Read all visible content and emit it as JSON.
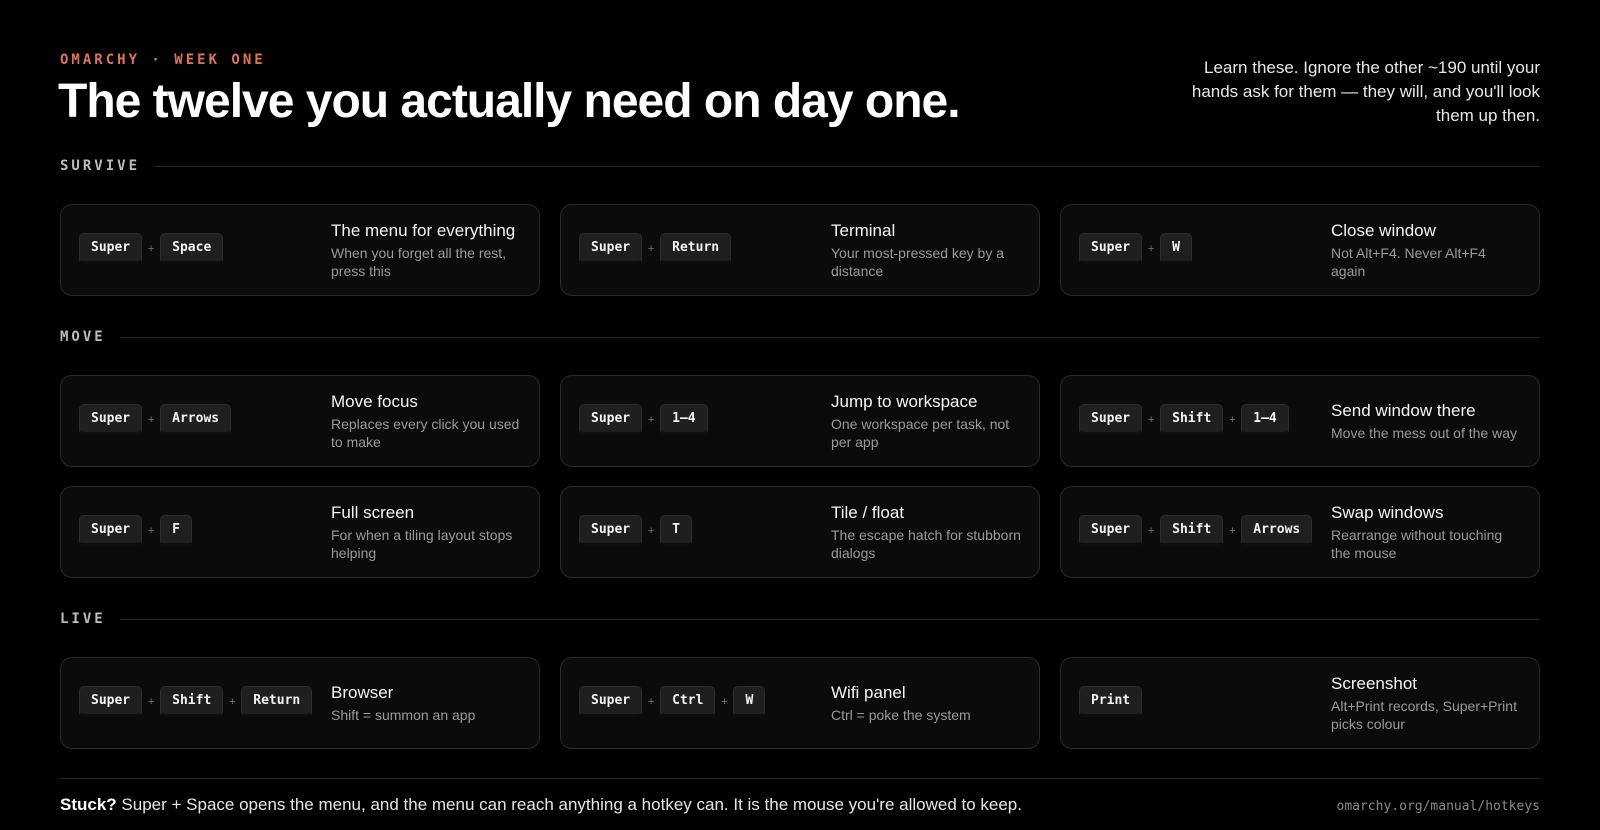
{
  "header": {
    "eyebrow": "OMARCHY · WEEK ONE",
    "title": "The twelve you actually need on day one.",
    "intro": "Learn these. Ignore the other ~190 until your hands ask for them — they will, and you'll look them up then."
  },
  "sections": {
    "survive": "SURVIVE",
    "move": "MOVE",
    "live": "LIVE"
  },
  "cards": [
    {
      "keys": [
        "Super",
        "Space"
      ],
      "title": "The menu for everything",
      "desc": "When you forget all the rest, press this"
    },
    {
      "keys": [
        "Super",
        "Return"
      ],
      "title": "Terminal",
      "desc": "Your most-pressed key by a distance"
    },
    {
      "keys": [
        "Super",
        "W"
      ],
      "title": "Close window",
      "desc": "Not Alt+F4. Never Alt+F4 again"
    },
    {
      "keys": [
        "Super",
        "Arrows"
      ],
      "title": "Move focus",
      "desc": "Replaces every click you used to make"
    },
    {
      "keys": [
        "Super",
        "1–4"
      ],
      "title": "Jump to workspace",
      "desc": "One workspace per task, not per app"
    },
    {
      "keys": [
        "Super",
        "Shift",
        "1–4"
      ],
      "title": "Send window there",
      "desc": "Move the mess out of the way"
    },
    {
      "keys": [
        "Super",
        "F"
      ],
      "title": "Full screen",
      "desc": "For when a tiling layout stops helping"
    },
    {
      "keys": [
        "Super",
        "T"
      ],
      "title": "Tile / float",
      "desc": "The escape hatch for stubborn dialogs"
    },
    {
      "keys": [
        "Super",
        "Shift",
        "Arrows"
      ],
      "title": "Swap windows",
      "desc": "Rearrange without touching the mouse"
    },
    {
      "keys": [
        "Super",
        "Shift",
        "Return"
      ],
      "title": "Browser",
      "desc": "Shift = summon an app"
    },
    {
      "keys": [
        "Super",
        "Ctrl",
        "W"
      ],
      "title": "Wifi panel",
      "desc": "Ctrl = poke the system"
    },
    {
      "keys": [
        "Print"
      ],
      "title": "Screenshot",
      "desc": "Alt+Print records, Super+Print picks colour"
    }
  ],
  "plus_sign": "+",
  "footer": {
    "lead": "Stuck?",
    "text": " Super + Space opens the menu, and the menu can reach anything a hotkey can. It is the mouse you're allowed to keep.",
    "link": "omarchy.org/manual/hotkeys"
  }
}
